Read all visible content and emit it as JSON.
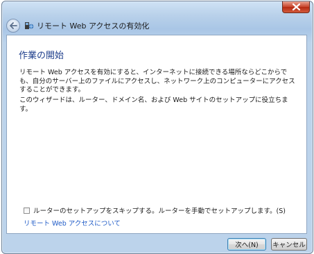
{
  "window": {
    "title": "リモート Web アクセスの有効化"
  },
  "page": {
    "heading": "作業の開始",
    "paragraph1": "リモート Web アクセスを有効にすると、インターネットに接続できる場所ならどこからでも、自分のサーバー上のファイルにアクセスし、ネットワーク上のコンピューターにアクセスすることができます。",
    "paragraph2": "このウィザードは、ルーター、ドメイン名、および Web サイトのセットアップに役立ちます。",
    "skip_checkbox": {
      "label": "ルーターのセットアップをスキップする。ルーターを手動でセットアップします。(S)",
      "checked": false
    },
    "help_link": "リモート Web アクセスについて"
  },
  "footer": {
    "next_label": "次へ(N)",
    "cancel_label": "キャンセル"
  },
  "icons": {
    "back": "back-arrow-icon",
    "app": "remote-access-icon",
    "close": "close-icon"
  },
  "colors": {
    "heading": "#1e3e8c",
    "link": "#1f5bc7",
    "close_button": "#c8432b"
  }
}
